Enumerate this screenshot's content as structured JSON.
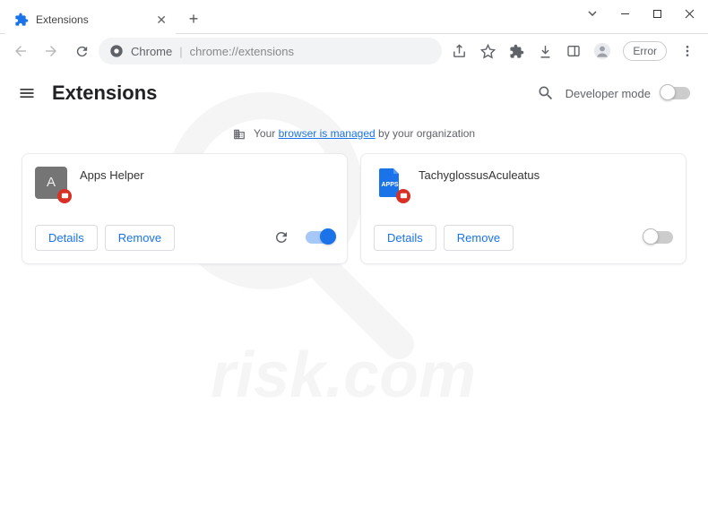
{
  "tab": {
    "title": "Extensions"
  },
  "omnibox": {
    "prefix": "Chrome",
    "url": "chrome://extensions"
  },
  "toolbar_error": "Error",
  "page": {
    "title": "Extensions",
    "dev_mode_label": "Developer mode"
  },
  "managed": {
    "prefix": "Your ",
    "link": "browser is managed",
    "suffix": " by your organization"
  },
  "buttons": {
    "details": "Details",
    "remove": "Remove"
  },
  "extensions": [
    {
      "name": "Apps Helper",
      "icon_letter": "A",
      "enabled": true,
      "icon_style": "letter"
    },
    {
      "name": "TachyglossusAculeatus",
      "icon_letter": "APPS",
      "enabled": false,
      "icon_style": "doc"
    }
  ]
}
